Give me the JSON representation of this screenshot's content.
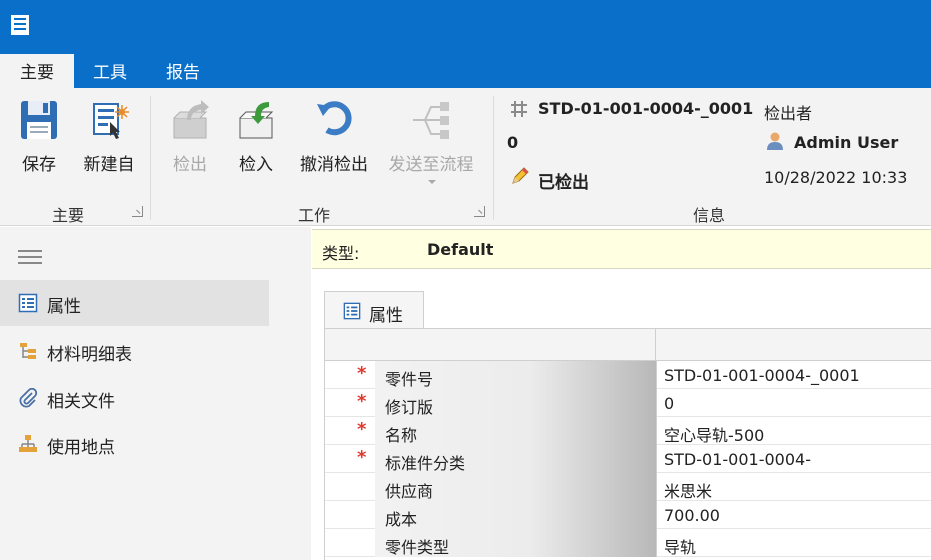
{
  "tabs": [
    {
      "label": "主要",
      "active": true
    },
    {
      "label": "工具",
      "active": false
    },
    {
      "label": "报告",
      "active": false
    }
  ],
  "ribbon": {
    "main_group": {
      "label": "主要",
      "buttons": [
        {
          "label": "保存",
          "icon": "save-icon",
          "enabled": true
        },
        {
          "label": "新建自",
          "icon": "new-from-icon",
          "enabled": true
        }
      ]
    },
    "work_group": {
      "label": "工作",
      "buttons": [
        {
          "label": "检出",
          "icon": "check-out-icon",
          "enabled": false
        },
        {
          "label": "检入",
          "icon": "check-in-icon",
          "enabled": true
        },
        {
          "label": "撤消检出",
          "icon": "undo-check-out-icon",
          "enabled": true
        },
        {
          "label": "发送至流程",
          "icon": "workflow-icon",
          "enabled": false
        }
      ]
    },
    "info_group": {
      "label": "信息",
      "part_number_line1": "STD-01-001-0004-_0001",
      "part_number_line2": "0",
      "status": "已检出",
      "checked_out_by_label": "检出者",
      "user": "Admin User",
      "datetime": "10/28/2022 10:33"
    }
  },
  "sidebar": {
    "items": [
      {
        "label": "属性",
        "icon": "properties-icon",
        "active": true
      },
      {
        "label": "材料明细表",
        "icon": "bom-icon",
        "active": false
      },
      {
        "label": "相关文件",
        "icon": "attachment-icon",
        "active": false
      },
      {
        "label": "使用地点",
        "icon": "where-used-icon",
        "active": false
      }
    ]
  },
  "typebar": {
    "label": "类型:",
    "value": "Default"
  },
  "content_tab": {
    "label": "属性"
  },
  "properties": [
    {
      "label": "零件号",
      "value": "STD-01-001-0004-_0001",
      "required": true
    },
    {
      "label": "修订版",
      "value": "0",
      "required": true
    },
    {
      "label": "名称",
      "value": "空心导轨-500",
      "required": true
    },
    {
      "label": "标准件分类",
      "value": "STD-01-001-0004-",
      "required": true
    },
    {
      "label": "供应商",
      "value": "米思米",
      "required": false
    },
    {
      "label": "成本",
      "value": "700.00",
      "required": false
    },
    {
      "label": "零件类型",
      "value": "导轨",
      "required": false
    }
  ],
  "colors": {
    "titlebar": "#0a6fc8",
    "ribbon_bg": "#f3f3f3",
    "type_bar_bg": "#ffffe1",
    "required_mark": "#e03a2f"
  }
}
